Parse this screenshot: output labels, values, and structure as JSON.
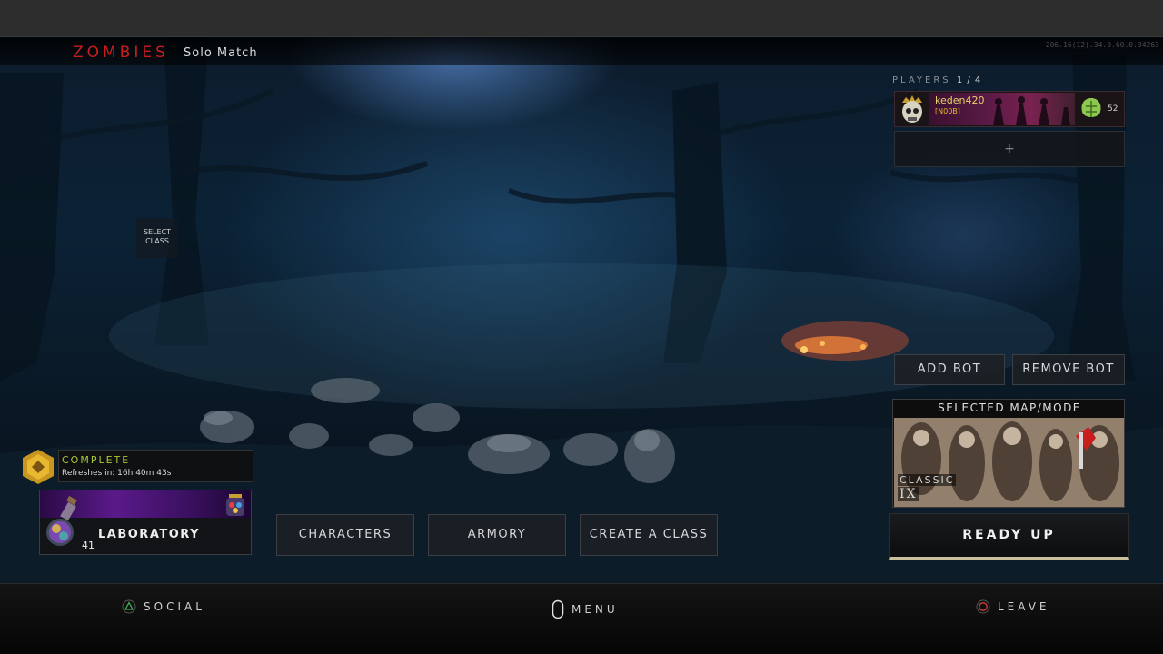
{
  "header": {
    "game_mode": "ZOMBIES",
    "match_type": "Solo Match",
    "build_id": "206.16(12).34.0.60.0.34263"
  },
  "select_class": {
    "line1": "SELECT",
    "line2": "CLASS"
  },
  "players": {
    "label": "PLAYERS",
    "count": "1 / 4",
    "slots": [
      {
        "name": "keden420",
        "clan_tag": "[N00B]",
        "level": "52"
      }
    ],
    "empty_slot_label": "+"
  },
  "bot_controls": {
    "add_label": "ADD BOT",
    "remove_label": "REMOVE BOT"
  },
  "selected_map": {
    "heading": "SELECTED MAP/MODE",
    "mode": "CLASSIC",
    "number": "IX"
  },
  "ready_up": {
    "label": "READY UP"
  },
  "challenge": {
    "status": "COMPLETE",
    "refresh_text": "Refreshes in: 16h 40m 43s"
  },
  "laboratory": {
    "label": "LABORATORY",
    "count": "41"
  },
  "menu_buttons": {
    "characters": "CHARACTERS",
    "armory": "ARMORY",
    "create_class": "CREATE A CLASS"
  },
  "footer": {
    "social": {
      "icon": "triangle-button-icon",
      "label": "SOCIAL",
      "color": "#3fae5a"
    },
    "menu": {
      "icon": "touchpad-button-icon",
      "label": "MENU"
    },
    "leave": {
      "icon": "circle-button-icon",
      "label": "LEAVE",
      "color": "#d23a3a"
    }
  },
  "colors": {
    "zombies_red": "#c81e1e",
    "complete_green": "#a8c838",
    "player_gold": "#e8d36a"
  }
}
